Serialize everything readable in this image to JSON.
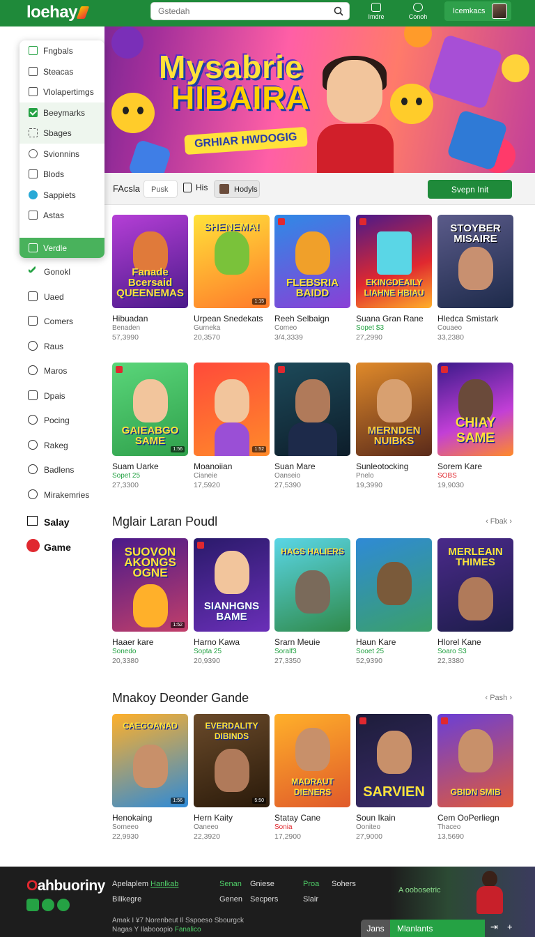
{
  "header": {
    "logo": "loehay",
    "search_placeholder": "Gstedah",
    "btn1": "Imdre",
    "btn2": "Conoh",
    "account_label": "Icemkacs"
  },
  "banner": {
    "title_line1": "Mysabrie",
    "title_line2": "HIBAIRA",
    "subtitle": "GRHIAR HWDOGIG"
  },
  "dropdown": [
    {
      "label": "Fngbals",
      "state": "green-outline"
    },
    {
      "label": "Steacas",
      "state": "outline"
    },
    {
      "label": "Vlolapertimgs",
      "state": "outline"
    },
    {
      "label": "Beeymarks",
      "state": "checked"
    },
    {
      "label": "Sbages",
      "state": "checked-light"
    },
    {
      "label": "Svionnins",
      "state": "outline"
    },
    {
      "label": "Blods",
      "state": "outline"
    },
    {
      "label": "Sappiets",
      "state": "teal"
    },
    {
      "label": "Astas",
      "state": "outline"
    }
  ],
  "dropdown_active": "Verdle",
  "sidebar": {
    "items": [
      "Gonokl",
      "Uaed",
      "Comers",
      "Raus",
      "Maros",
      "Dpais",
      "Pocing",
      "Rakeg",
      "Badlens",
      "Mirakemries"
    ],
    "strong": [
      "Salay",
      "Game"
    ]
  },
  "filter": {
    "label": "FAcsla",
    "pill": "Pusk",
    "his": "His",
    "user_pill": "Hodyls",
    "cta": "Svepn Init"
  },
  "rows": [
    {
      "cards": [
        {
          "thumb": "Fanade Bcersaid\nQUEENEMAS",
          "title": "Hibuadan",
          "sub": "Benaden",
          "sub_color": "gray",
          "meta": "57,3990"
        },
        {
          "thumb": "SHENEMA!",
          "title": "Urpean Snedekats",
          "sub": "Gurneka",
          "sub_color": "gray",
          "meta": "20,3570"
        },
        {
          "thumb": "FLEBSRIA BAIDD",
          "title": "Reeh Selbaign",
          "sub": "Comeo",
          "sub_color": "gray",
          "meta": "3/4,3339"
        },
        {
          "thumb": "EKINGDEAILY LIAHNE HBIAU",
          "title": "Suana Gran Rane",
          "sub": "Sopet $3",
          "sub_color": "green",
          "meta": "27,2990"
        },
        {
          "thumb": "STOYBER MISAIRE",
          "title": "Hledca Smistark",
          "sub": "Couaeo",
          "sub_color": "gray",
          "meta": "33,2380"
        }
      ]
    },
    {
      "cards": [
        {
          "thumb": "GAIEABGO SAME",
          "title": "Suam Uarke",
          "sub": "Sopet 25",
          "sub_color": "green",
          "meta": "27,3300"
        },
        {
          "thumb": "",
          "title": "Moanoiian",
          "sub": "Cianeie",
          "sub_color": "gray",
          "meta": "17,5920"
        },
        {
          "thumb": "",
          "title": "Suan Mare",
          "sub": "Oanseio",
          "sub_color": "gray",
          "meta": "27,5390"
        },
        {
          "thumb": "MERNDEN NUIBKS",
          "title": "Sunleotocking",
          "sub": "Pnelo",
          "sub_color": "gray",
          "meta": "19,3990"
        },
        {
          "thumb": "CHIAY SAME",
          "title": "Sorem Kare",
          "sub": "SOBS",
          "sub_color": "red",
          "meta": "19,9030"
        }
      ]
    },
    {
      "title": "Mglair Laran Poudl",
      "link": "Fbak",
      "cards": [
        {
          "thumb": "SUOVON AKONGS OGNE",
          "title": "Haaer kare",
          "sub": "Sonedo",
          "sub_color": "green",
          "meta": "20,3380"
        },
        {
          "thumb": "SIANHGNS BAME",
          "title": "Harno Kawa",
          "sub": "Sopta 25",
          "sub_color": "green",
          "meta": "20,9390"
        },
        {
          "thumb": "HAGS HALIERS",
          "title": "Srarn Meuie",
          "sub": "Soralf3",
          "sub_color": "green",
          "meta": "27,3350"
        },
        {
          "thumb": "",
          "title": "Haun Kare",
          "sub": "Sooet 25",
          "sub_color": "green",
          "meta": "52,9390"
        },
        {
          "thumb": "MERLEAIN THIMES",
          "title": "Hlorel Kane",
          "sub": "Soaro S3",
          "sub_color": "green",
          "meta": "22,3380"
        }
      ]
    },
    {
      "title": "Mnakoy Deonder Gande",
      "link": "Pash",
      "cards": [
        {
          "thumb": "CAEGOANAD",
          "title": "Henokaing",
          "sub": "Sorneeo",
          "sub_color": "gray",
          "meta": "22,9930"
        },
        {
          "thumb": "EVERDALITY DIBINDS",
          "title": "Hern Kaity",
          "sub": "Oaneeo",
          "sub_color": "gray",
          "meta": "22,3920"
        },
        {
          "thumb": "MADRAUT DIENERS",
          "title": "Statay Cane",
          "sub": "Sonia",
          "sub_color": "red",
          "meta": "17,2900"
        },
        {
          "thumb": "SARVIEN",
          "title": "Soun Ikain",
          "sub": "Ooniteo",
          "sub_color": "gray",
          "meta": "27,9000"
        },
        {
          "thumb": "GBIDN SMIB",
          "title": "Cem OoPerliegn",
          "sub": "Thaceo",
          "sub_color": "gray",
          "meta": "13,5690"
        }
      ]
    }
  ],
  "footer": {
    "logo_mark": "O",
    "logo": "ahbuoriny",
    "col1a": "Apelaplem",
    "col1a_green": "Hanlkab",
    "col1b": "Bilikegre",
    "col2a": "Senan",
    "col2b": "Genen",
    "col3a": "Gniese",
    "col3b": "Secpers",
    "col4a": "Proa",
    "col4b": "Slair",
    "col5a": "Sohers",
    "promo": "A oobosetric",
    "tiny1": "Amak I ¥7 Norenbeut Il Sspoeso Sbourgck",
    "tiny2": "Nagas Y Ilabooopio",
    "tiny2_green": "Fanalico",
    "tab_dark": "Jans",
    "tab_green": "Mlanlants",
    "corner_left": "⇥",
    "corner_right": "+"
  }
}
